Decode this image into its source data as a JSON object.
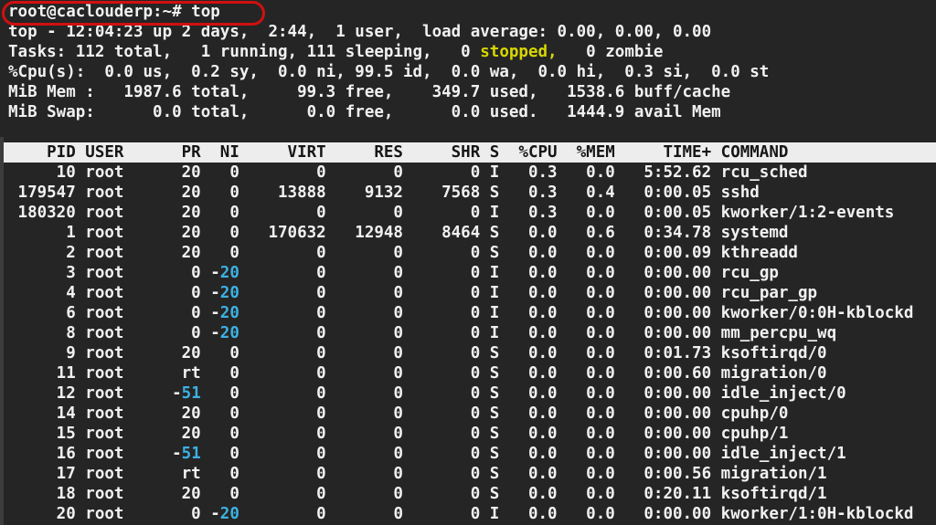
{
  "terminal": {
    "prompt": "root@caclouderp:~# top",
    "summary_lines": [
      [
        {
          "text": "top - 12:04:23 up 2 days,  2:44,  1 user,  load average: 0.00, 0.00, 0.00"
        }
      ],
      [
        {
          "text": "Tasks: 112 total,   1 running, 111 sleeping,   0 "
        },
        {
          "text": "stopped,",
          "color": "yellow"
        },
        {
          "text": "   0 zombie"
        }
      ],
      [
        {
          "text": "%Cpu(s):  0.0 us,  0.2 sy,  0.0 ni, 99.5 id,  0.0 wa,  0.0 hi,  0.3 si,  0.0 st"
        }
      ],
      [
        {
          "text": "MiB Mem :   1987.6 total,     99.3 free,    349.7 used,   1538.6 buff/cache"
        }
      ],
      [
        {
          "text": "MiB Swap:      0.0 total,      0.0 free,      0.0 used.   1444.9 avail Mem"
        }
      ]
    ],
    "process_table": {
      "columns": [
        "PID",
        "USER",
        "PR",
        "NI",
        "VIRT",
        "RES",
        "SHR",
        "S",
        "%CPU",
        "%MEM",
        "TIME+",
        "COMMAND"
      ],
      "rows": [
        [
          "10",
          "root",
          "20",
          "0",
          "0",
          "0",
          "0",
          "I",
          "0.3",
          "0.0",
          "5:52.62",
          "rcu_sched"
        ],
        [
          "179547",
          "root",
          "20",
          "0",
          "13888",
          "9132",
          "7568",
          "S",
          "0.3",
          "0.4",
          "0:00.05",
          "sshd"
        ],
        [
          "180320",
          "root",
          "20",
          "0",
          "0",
          "0",
          "0",
          "I",
          "0.3",
          "0.0",
          "0:00.05",
          "kworker/1:2-events"
        ],
        [
          "1",
          "root",
          "20",
          "0",
          "170632",
          "12948",
          "8464",
          "S",
          "0.0",
          "0.6",
          "0:34.78",
          "systemd"
        ],
        [
          "2",
          "root",
          "20",
          "0",
          "0",
          "0",
          "0",
          "S",
          "0.0",
          "0.0",
          "0:00.09",
          "kthreadd"
        ],
        [
          "3",
          "root",
          "0",
          "-20",
          "0",
          "0",
          "0",
          "I",
          "0.0",
          "0.0",
          "0:00.00",
          "rcu_gp"
        ],
        [
          "4",
          "root",
          "0",
          "-20",
          "0",
          "0",
          "0",
          "I",
          "0.0",
          "0.0",
          "0:00.00",
          "rcu_par_gp"
        ],
        [
          "6",
          "root",
          "0",
          "-20",
          "0",
          "0",
          "0",
          "I",
          "0.0",
          "0.0",
          "0:00.00",
          "kworker/0:0H-kblockd"
        ],
        [
          "8",
          "root",
          "0",
          "-20",
          "0",
          "0",
          "0",
          "I",
          "0.0",
          "0.0",
          "0:00.00",
          "mm_percpu_wq"
        ],
        [
          "9",
          "root",
          "20",
          "0",
          "0",
          "0",
          "0",
          "S",
          "0.0",
          "0.0",
          "0:01.73",
          "ksoftirqd/0"
        ],
        [
          "11",
          "root",
          "rt",
          "0",
          "0",
          "0",
          "0",
          "S",
          "0.0",
          "0.0",
          "0:00.60",
          "migration/0"
        ],
        [
          "12",
          "root",
          "-51",
          "0",
          "0",
          "0",
          "0",
          "S",
          "0.0",
          "0.0",
          "0:00.00",
          "idle_inject/0"
        ],
        [
          "14",
          "root",
          "20",
          "0",
          "0",
          "0",
          "0",
          "S",
          "0.0",
          "0.0",
          "0:00.00",
          "cpuhp/0"
        ],
        [
          "15",
          "root",
          "20",
          "0",
          "0",
          "0",
          "0",
          "S",
          "0.0",
          "0.0",
          "0:00.00",
          "cpuhp/1"
        ],
        [
          "16",
          "root",
          "-51",
          "0",
          "0",
          "0",
          "0",
          "S",
          "0.0",
          "0.0",
          "0:00.00",
          "idle_inject/1"
        ],
        [
          "17",
          "root",
          "rt",
          "0",
          "0",
          "0",
          "0",
          "S",
          "0.0",
          "0.0",
          "0:00.56",
          "migration/1"
        ],
        [
          "18",
          "root",
          "20",
          "0",
          "0",
          "0",
          "0",
          "S",
          "0.0",
          "0.0",
          "0:20.11",
          "ksoftirqd/1"
        ],
        [
          "20",
          "root",
          "0",
          "-20",
          "0",
          "0",
          "0",
          "I",
          "0.0",
          "0.0",
          "0:00.00",
          "kworker/1:0H-kblockd"
        ]
      ]
    }
  },
  "annotation": {
    "type": "red-oval",
    "around": "root@caclouderp:~# top",
    "color": "#d01010"
  },
  "colors": {
    "background": "#252525",
    "foreground": "#f1f1f1",
    "stopped_yellow": "#d7d700",
    "negative_nice_cyan": "#3cb1e3",
    "table_header_background": "#ededed",
    "table_header_text": "#161616",
    "annotation_red": "#d01010"
  }
}
